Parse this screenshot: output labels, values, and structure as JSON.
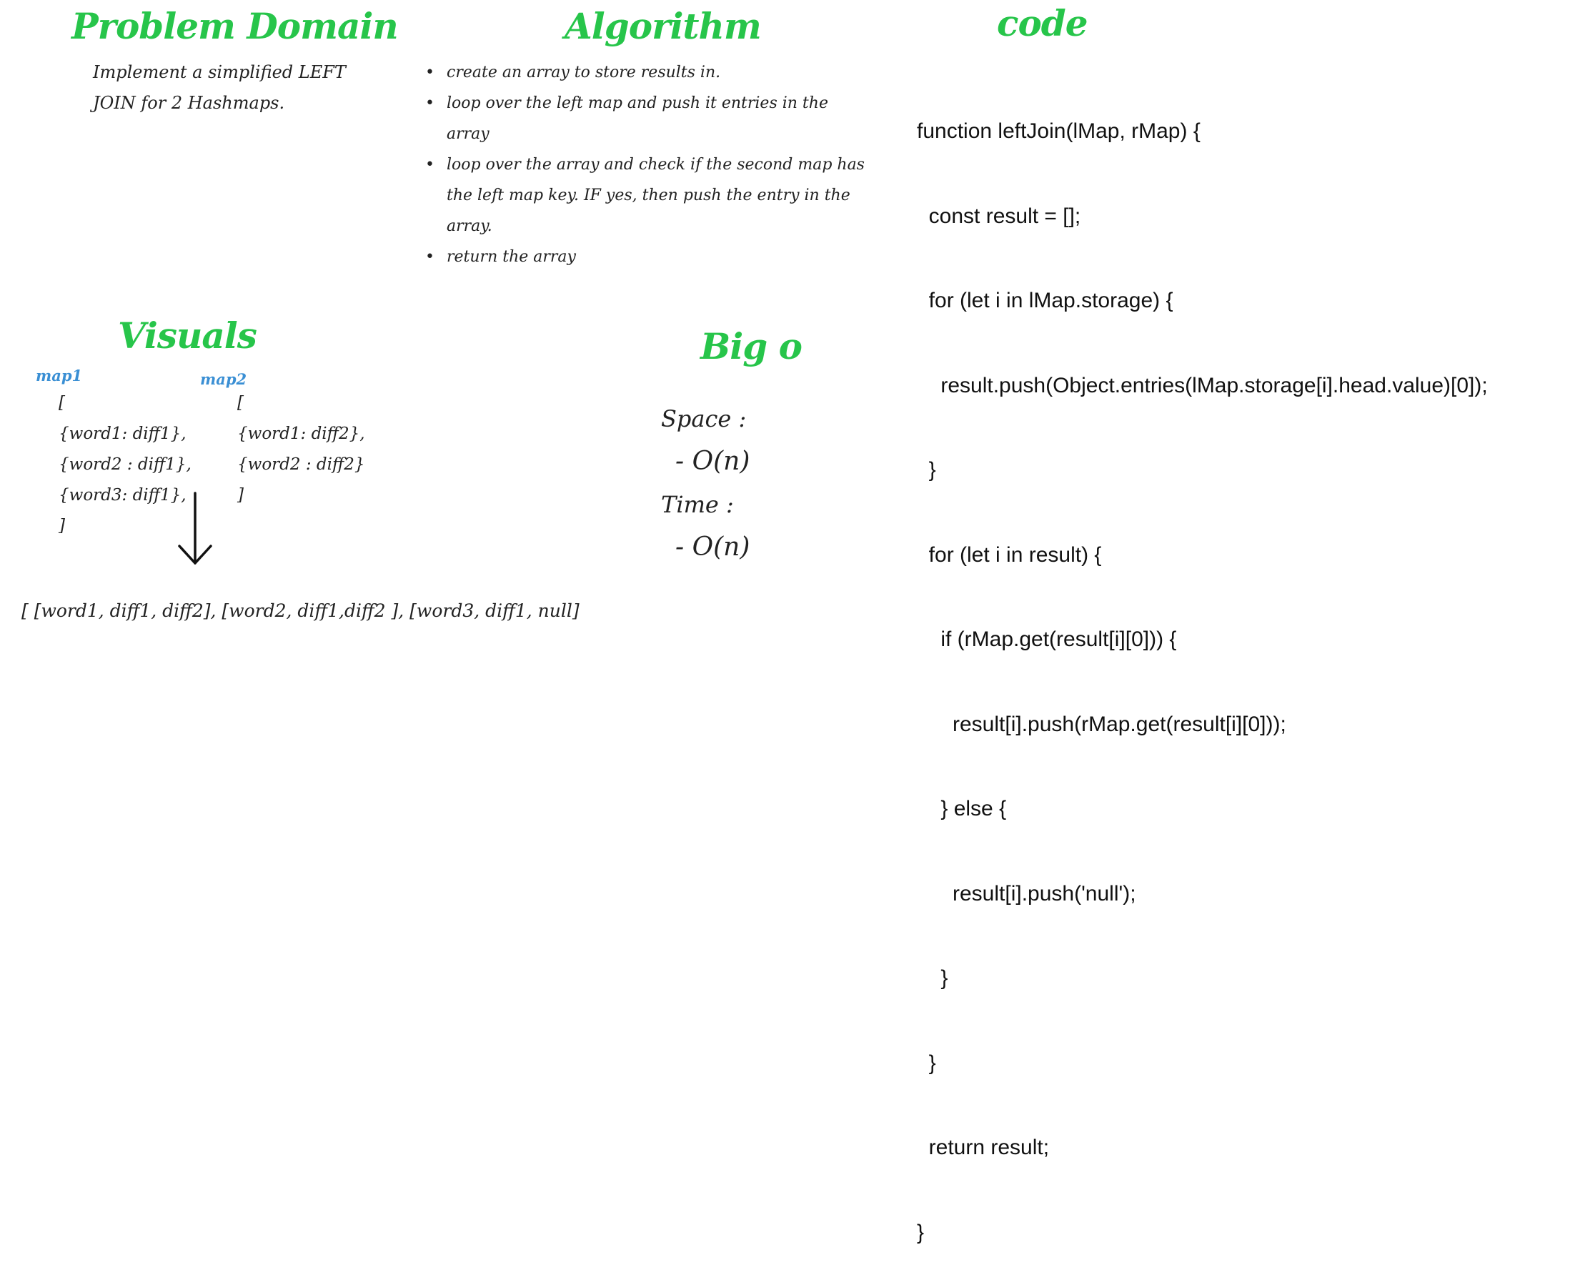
{
  "problem_domain": {
    "title": "Problem Domain",
    "lines": [
      "Implement a simplified LEFT",
      "JOIN for 2 Hashmaps."
    ]
  },
  "algorithm": {
    "title": "Algorithm",
    "steps": [
      "create an array to store results in.",
      "loop over the left map and push it entries in the array",
      "loop over the array and check if the second map has the left map key. IF yes, then push the entry in the array.",
      "return the array"
    ]
  },
  "code": {
    "title": "code",
    "lines": [
      "function leftJoin(lMap, rMap) {",
      "  const result = [];",
      "  for (let i in lMap.storage) {",
      "    result.push(Object.entries(lMap.storage[i].head.value)[0]);",
      "  }",
      "  for (let i in result) {",
      "    if (rMap.get(result[i][0])) {",
      "      result[i].push(rMap.get(result[i][0]));",
      "    } else {",
      "      result[i].push('null');",
      "    }",
      "  }",
      "  return result;",
      "}"
    ]
  },
  "visuals": {
    "title": "Visuals",
    "map1": {
      "label": "map1",
      "lines": [
        "[",
        "{word1: diff1},",
        "{word2 : diff1},",
        "{word3: diff1},",
        "]"
      ]
    },
    "map2": {
      "label": "map2",
      "lines": [
        "[",
        "{word1: diff2},",
        "{word2 : diff2}",
        "]"
      ]
    },
    "result": "[  [word1, diff1, diff2], [word2, diff1,diff2 ], [word3, diff1, null]"
  },
  "big_o": {
    "title": "Big o",
    "space_label": "Space :",
    "space_value": "- O(n)",
    "time_label": "Time :",
    "time_value": "- O(n)"
  },
  "colors": {
    "heading": "#27c54a",
    "map_label": "#3a8fd4",
    "text": "#222222"
  }
}
